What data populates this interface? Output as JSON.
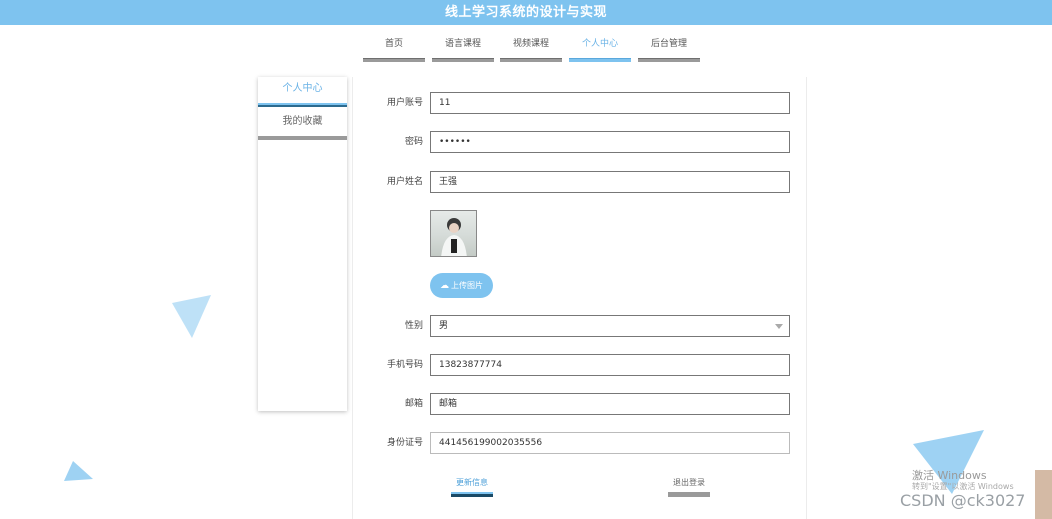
{
  "header": {
    "title": "线上学习系统的设计与实现"
  },
  "nav": {
    "items": [
      {
        "label": "首页"
      },
      {
        "label": "语言课程"
      },
      {
        "label": "视频课程"
      },
      {
        "label": "个人中心"
      },
      {
        "label": "后台管理"
      }
    ],
    "active_index": 3
  },
  "sidebar": {
    "items": [
      {
        "label": "个人中心"
      },
      {
        "label": "我的收藏"
      }
    ]
  },
  "form": {
    "account": {
      "label": "用户账号",
      "value": "11"
    },
    "password": {
      "label": "密码",
      "value": "••••••"
    },
    "name": {
      "label": "用户姓名",
      "value": "王强"
    },
    "upload_label": "上传图片",
    "gender": {
      "label": "性别",
      "value": "男"
    },
    "phone": {
      "label": "手机号码",
      "value": "13823877774"
    },
    "email": {
      "label": "邮箱",
      "value": "邮箱"
    },
    "id_card": {
      "label": "身份证号",
      "value": "441456199002035556"
    },
    "update_label": "更新信息",
    "logout_label": "退出登录"
  },
  "watermark": {
    "activate_title": "激活 Windows",
    "activate_sub": "转到\"设置\"以激活 Windows",
    "csdn": "CSDN @ck3027"
  },
  "colors": {
    "accent": "#7ec3ef",
    "dark_bar": "#2c6a8e",
    "gray_bar": "#9a9a9a"
  }
}
